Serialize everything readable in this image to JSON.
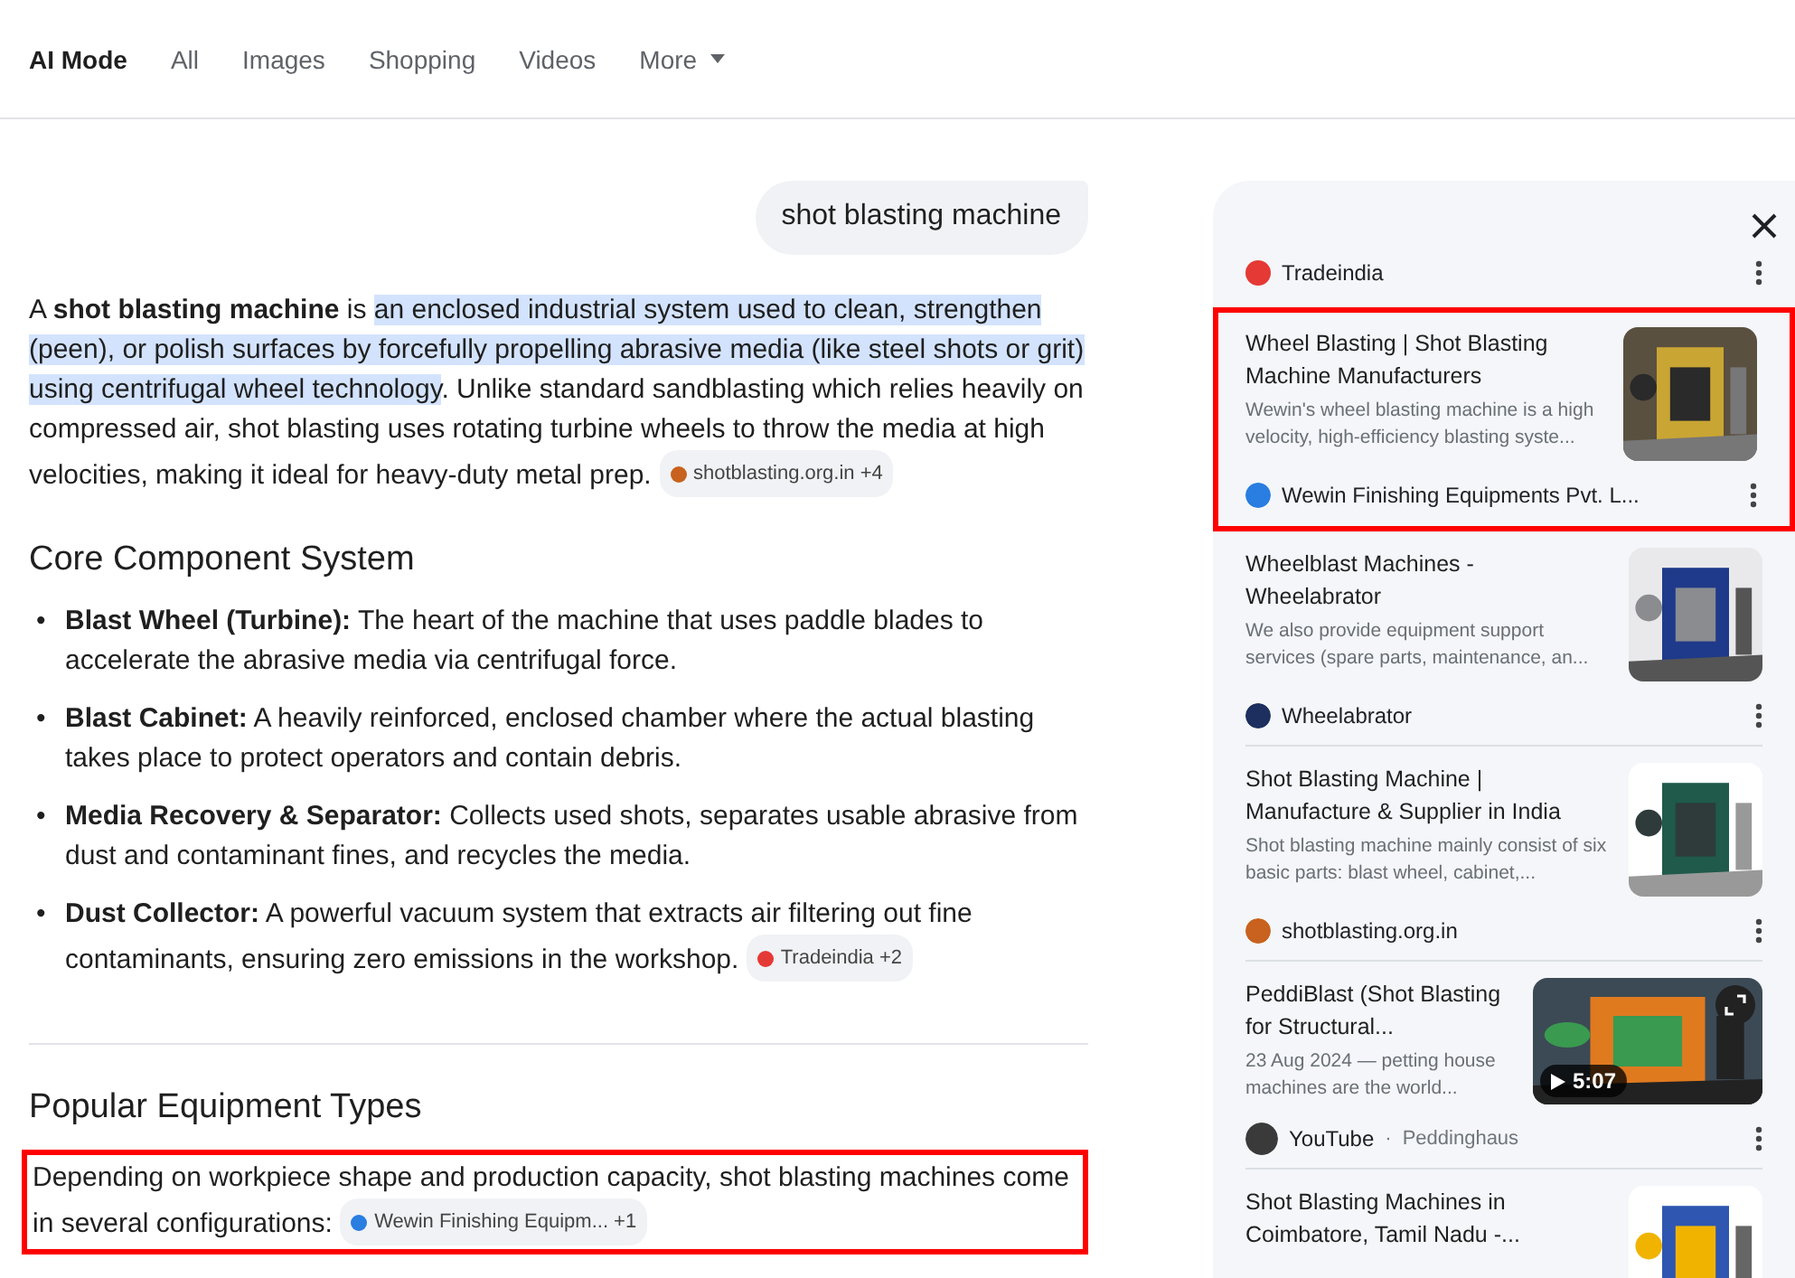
{
  "tabs": [
    {
      "label": "AI Mode",
      "selected": true,
      "kind": "tab"
    },
    {
      "label": "All",
      "selected": false,
      "kind": "tab"
    },
    {
      "label": "Images",
      "selected": false,
      "kind": "tab"
    },
    {
      "label": "Shopping",
      "selected": false,
      "kind": "tab"
    },
    {
      "label": "Videos",
      "selected": false,
      "kind": "tab"
    },
    {
      "label": "More",
      "selected": false,
      "kind": "menu"
    }
  ],
  "query": "shot blasting machine",
  "intro": {
    "segments": [
      {
        "kind": "plain",
        "text": "A "
      },
      {
        "kind": "bold",
        "text": "shot blasting machine"
      },
      {
        "kind": "plain",
        "text": " is "
      },
      {
        "kind": "highlight",
        "text": "an enclosed industrial system used to clean, strengthen (peen), or polish surfaces by forcefully propelling abrasive media (like steel shots or grit) using centrifugal wheel technology"
      },
      {
        "kind": "plain",
        "text": ". Unlike standard sandblasting which relies heavily on compressed air, shot blasting uses rotating turbine wheels to throw the media at high velocities, making it ideal for heavy-duty metal prep. "
      }
    ],
    "chip": {
      "label": "shotblasting.org.in +4",
      "color": "#c8621e"
    }
  },
  "sections": [
    {
      "heading": "Core Component System",
      "bullets": [
        {
          "marker": "•",
          "term": "Blast Wheel (Turbine):",
          "text": " The heart of the machine that uses paddle blades to accelerate the abrasive media via centrifugal force."
        },
        {
          "marker": "•",
          "term": "Blast Cabinet:",
          "text": " A heavily reinforced, enclosed chamber where the actual blasting takes place to protect operators and contain debris."
        },
        {
          "marker": "•",
          "term": "Media Recovery & Separator:",
          "text": " Collects used shots, separates usable abrasive from dust and contaminant fines, and recycles the media."
        },
        {
          "marker": "•",
          "term": "Dust Collector:",
          "text": " A powerful vacuum system that extracts air filtering out fine contaminants, ensuring zero emissions in the workshop. "
        }
      ],
      "chip": {
        "label": "Tradeindia +2",
        "color": "#e53935"
      }
    },
    {
      "heading": "Popular Equipment Types",
      "paragraph": "Depending on workpiece shape and production capacity, shot blasting machines come in several configurations: ",
      "highlighted": true,
      "chip": {
        "label": "Wewin Finishing Equipm...  +1",
        "color": "#2a7de1"
      }
    }
  ],
  "sources": {
    "top_source": {
      "name": "Tradeindia",
      "color": "#e53935"
    },
    "cards": [
      {
        "title": "Wheel Blasting | Shot Blasting Machine Manufacturers",
        "snippet": "Wewin's wheel blasting machine is a high velocity, high-efficiency blasting syste...",
        "source": "Wewin Finishing Equipments Pvt. L...",
        "color": "#2a7de1",
        "highlighted": true,
        "kind": "article"
      },
      {
        "title": "Wheelblast Machines - Wheelabrator",
        "snippet": "We also provide equipment support services (spare parts, maintenance, an...",
        "source": "Wheelabrator",
        "color": "#1c2f5e",
        "highlighted": false,
        "kind": "article"
      },
      {
        "title": "Shot Blasting Machine | Manufacture & Supplier in India",
        "snippet": "Shot blasting machine mainly consist of six basic parts: blast wheel, cabinet,...",
        "source": "shotblasting.org.in",
        "color": "#c8621e",
        "highlighted": false,
        "kind": "article"
      },
      {
        "title": "PeddiBlast (Shot Blasting for Structural...",
        "snippet": "23 Aug 2024 — petting house machines are the world...",
        "source": "YouTube",
        "separator": "·",
        "channel": "Peddinghaus",
        "duration": "5:07",
        "color": "#3a3a3a",
        "highlighted": false,
        "kind": "video"
      },
      {
        "title": "Shot Blasting Machines in Coimbatore, Tamil Nadu -...",
        "highlighted": false,
        "kind": "article"
      }
    ]
  }
}
